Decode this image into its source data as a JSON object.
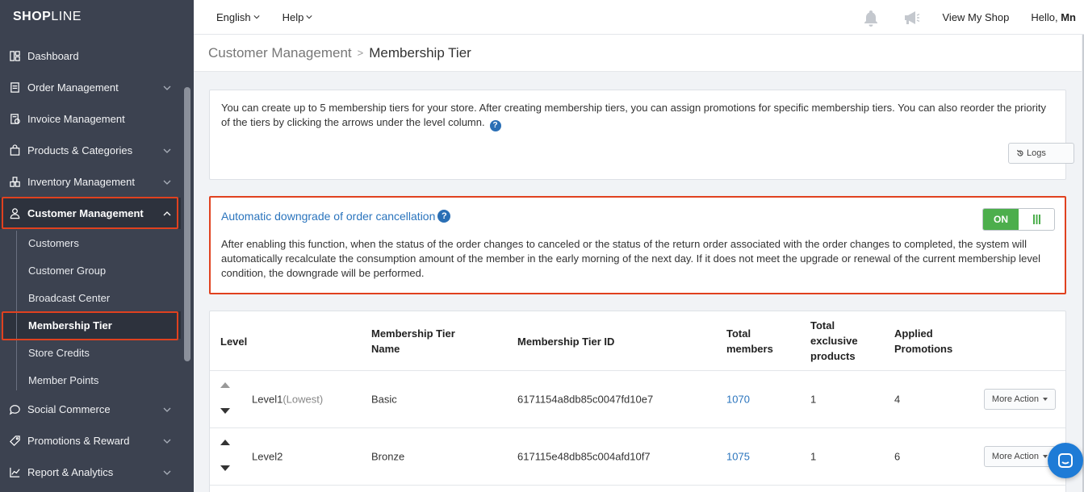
{
  "brand": {
    "logo_bold": "SHOP",
    "logo_thin": "LINE"
  },
  "sidebar": {
    "items": [
      {
        "label": "Dashboard",
        "icon": "dashboard-icon",
        "has_chevron": false
      },
      {
        "label": "Order Management",
        "icon": "order-icon",
        "has_chevron": true
      },
      {
        "label": "Invoice Management",
        "icon": "invoice-icon",
        "has_chevron": false
      },
      {
        "label": "Products & Categories",
        "icon": "bag-icon",
        "has_chevron": true
      },
      {
        "label": "Inventory Management",
        "icon": "inventory-icon",
        "has_chevron": true
      },
      {
        "label": "Customer Management",
        "icon": "user-icon",
        "has_chevron": true,
        "expanded": true
      },
      {
        "label": "Social Commerce",
        "icon": "chat-icon",
        "has_chevron": true
      },
      {
        "label": "Promotions & Reward",
        "icon": "tag-icon",
        "has_chevron": true
      },
      {
        "label": "Report & Analytics",
        "icon": "chart-icon",
        "has_chevron": true
      }
    ],
    "customer_sub": [
      "Customers",
      "Customer Group",
      "Broadcast Center",
      "Membership Tier",
      "Store Credits",
      "Member Points"
    ]
  },
  "topbar": {
    "language": "English",
    "help": "Help",
    "view_shop": "View My Shop",
    "hello_prefix": "Hello, ",
    "user": "Mn"
  },
  "breadcrumb": {
    "parent": "Customer Management",
    "current": "Membership Tier"
  },
  "info": {
    "text": "You can create up to 5 membership tiers for your store. After creating membership tiers, you can assign promotions for specific membership tiers. You can also reorder the priority of the tiers by clicking the arrows under the level column.",
    "help_glyph": "?",
    "logs_label": "Logs"
  },
  "auto_downgrade": {
    "title": "Automatic downgrade of order cancellation",
    "toggle_label": "ON",
    "description": "After enabling this function, when the status of the order changes to canceled or the status of the return order associated with the order changes to completed, the system will automatically recalculate the consumption amount of the member in the early morning of the next day. If it does not meet the upgrade or renewal of the current membership level condition, the downgrade will be performed."
  },
  "table": {
    "headers": {
      "level": "Level",
      "name_1": "Membership Tier",
      "name_2": "Name",
      "id": "Membership Tier ID",
      "members_1": "Total",
      "members_2": "members",
      "products_1": "Total",
      "products_2": "exclusive",
      "products_3": "products",
      "promos_1": "Applied",
      "promos_2": "Promotions"
    },
    "rows": [
      {
        "level": "Level1",
        "level_note": "(Lowest)",
        "name": "Basic",
        "id": "6171154a8db85c0047fd10e7",
        "members": "1070",
        "products": "1",
        "promotions": "4",
        "action": "More Action"
      },
      {
        "level": "Level2",
        "level_note": "",
        "name": "Bronze",
        "id": "617115e48db85c004afd10f7",
        "members": "1075",
        "products": "1",
        "promotions": "6",
        "action": "More Action"
      }
    ]
  },
  "colors": {
    "sidebar_bg": "#3c4250",
    "highlight_border": "#e0411f",
    "link_blue": "#2a74bd",
    "toggle_green": "#4cae4c",
    "chat_blue": "#1e7bd6"
  }
}
